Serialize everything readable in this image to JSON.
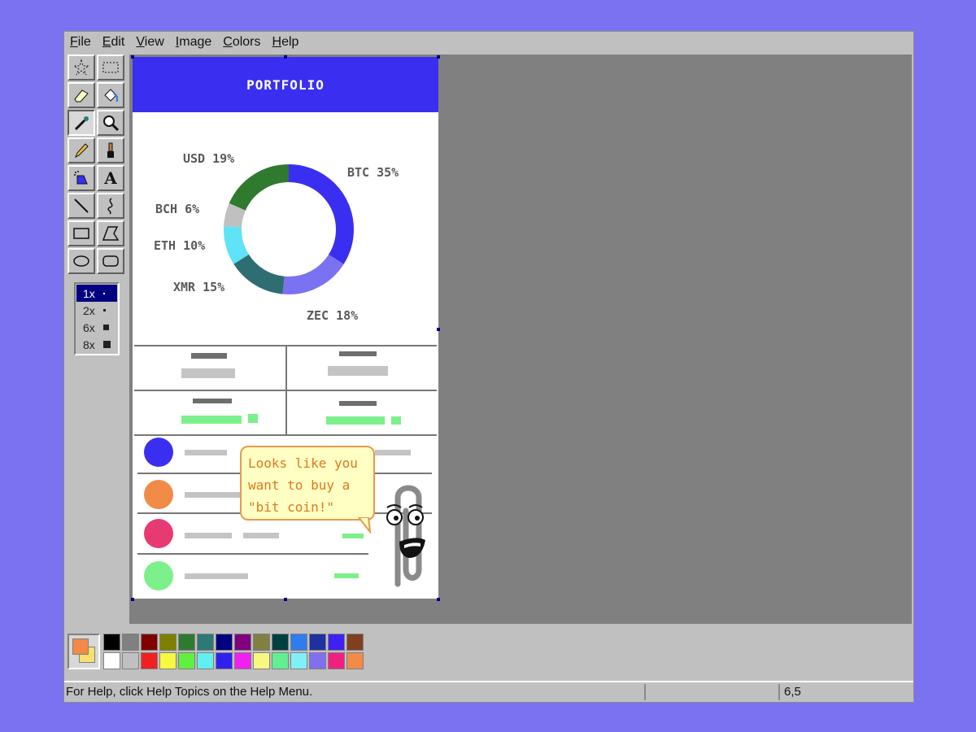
{
  "menu": [
    {
      "accel": "F",
      "rest": "ile"
    },
    {
      "accel": "E",
      "rest": "dit"
    },
    {
      "accel": "V",
      "rest": "iew"
    },
    {
      "accel": "I",
      "rest": "mage"
    },
    {
      "accel": "C",
      "rest": "olors"
    },
    {
      "accel": "H",
      "rest": "elp"
    }
  ],
  "tools": [
    "free-form-select-icon",
    "select-icon",
    "eraser-icon",
    "fill-bucket-icon",
    "color-picker-icon",
    "magnifier-icon",
    "pencil-icon",
    "brush-icon",
    "airbrush-icon",
    "text-icon",
    "line-icon",
    "curve-icon",
    "rectangle-icon",
    "polygon-icon",
    "ellipse-icon",
    "rounded-rectangle-icon"
  ],
  "text_tool_glyph": "A",
  "zoom": [
    {
      "label": "1x",
      "selected": true
    },
    {
      "label": "2x",
      "selected": false
    },
    {
      "label": "6x",
      "selected": false
    },
    {
      "label": "8x",
      "selected": false
    }
  ],
  "canvas": {
    "title": "PORTFOLIO",
    "banner_color": "#3a2ff0",
    "chart_data": {
      "type": "pie",
      "donut": true,
      "slices": [
        {
          "label": "BTC 35%",
          "value": 35,
          "color": "#3a2ff0"
        },
        {
          "label": "ZEC 18%",
          "value": 18,
          "color": "#7b72f2"
        },
        {
          "label": "XMR 15%",
          "value": 15,
          "color": "#2e6e73"
        },
        {
          "label": "ETH 10%",
          "value": 10,
          "color": "#5fe3f7"
        },
        {
          "label": "BCH 6%",
          "value": 6,
          "color": "#c0c0c0"
        },
        {
          "label": "USD 19%",
          "value": 19,
          "color": "#2f7a2f"
        }
      ]
    },
    "list_dot_colors": [
      "#3a2ff0",
      "#f28a48",
      "#e83a72",
      "#7cf08a"
    ],
    "clippy_bubble": [
      "Looks like you",
      "want to buy a",
      "\"bit coin!\""
    ]
  },
  "palette": {
    "foreground": "#f28a48",
    "background": "#f5e070",
    "row1": [
      "#000000",
      "#808080",
      "#800000",
      "#808000",
      "#2f7a2f",
      "#2e7878",
      "#000080",
      "#800080",
      "#808040",
      "#004040",
      "#2f7cf0",
      "#2030a0",
      "#4020f0",
      "#804020"
    ],
    "row2": [
      "#ffffff",
      "#c0c0c0",
      "#f02020",
      "#f8f840",
      "#60f040",
      "#60f0f0",
      "#3020f0",
      "#f020f0",
      "#f8f880",
      "#60f090",
      "#80f0f8",
      "#8070f0",
      "#f02080",
      "#f28a48"
    ]
  },
  "status": {
    "help": "For Help, click Help Topics on the Help Menu.",
    "coords": "6,5"
  }
}
